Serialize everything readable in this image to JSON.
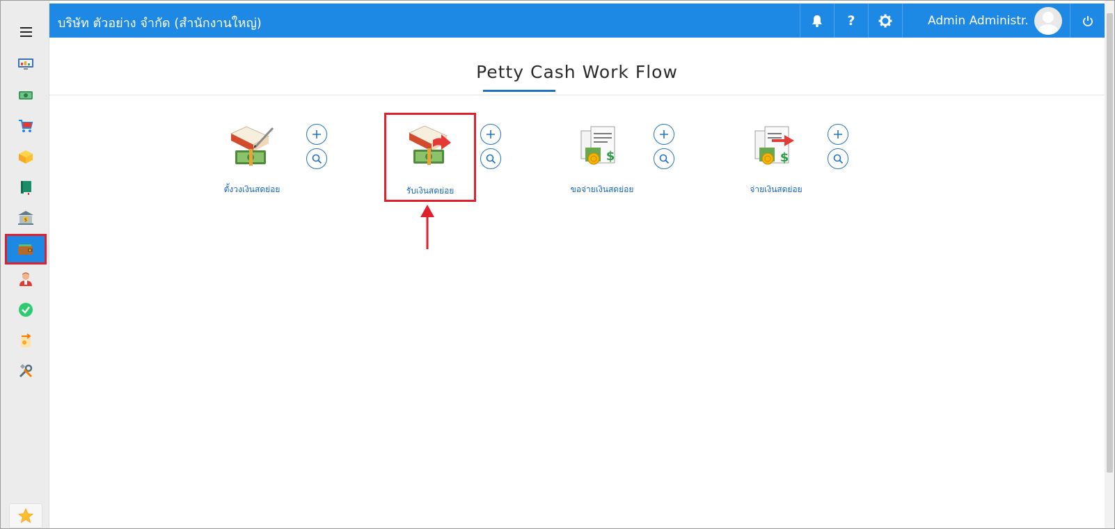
{
  "header": {
    "company": "บริษัท ตัวอย่าง จำกัด (สำนักงานใหญ่)",
    "user_name": "Admin Administr...",
    "icons": [
      "bell-icon",
      "help-icon",
      "gear-icon",
      "power-icon"
    ]
  },
  "sidebar": {
    "items": [
      {
        "name": "dashboard",
        "icon": "monitor-chart-icon"
      },
      {
        "name": "money",
        "icon": "banknote-icon"
      },
      {
        "name": "purchase",
        "icon": "cart-icon"
      },
      {
        "name": "inventory",
        "icon": "box-icon"
      },
      {
        "name": "ledger",
        "icon": "book-icon"
      },
      {
        "name": "bank",
        "icon": "bank-icon"
      },
      {
        "name": "petty-cash",
        "icon": "wallet-icon",
        "active": true
      },
      {
        "name": "hr",
        "icon": "person-icon"
      },
      {
        "name": "approve",
        "icon": "check-icon"
      },
      {
        "name": "transfer",
        "icon": "transfer-icon"
      },
      {
        "name": "settings",
        "icon": "tools-icon"
      }
    ],
    "favorite_icon": "star-icon"
  },
  "main": {
    "title": "Petty Cash Work Flow",
    "workflow": [
      {
        "label": "ตั้งวงเงินสดย่อย",
        "icon": "ledger-pen-icon"
      },
      {
        "label": "รับเงินสดย่อย",
        "icon": "ledger-arrow-icon",
        "highlighted": true
      },
      {
        "label": "ขอจ่ายเงินสดย่อย",
        "icon": "receipt-dollar-icon"
      },
      {
        "label": "จ่ายเงินสดย่อย",
        "icon": "receipt-arrow-icon"
      }
    ]
  },
  "colors": {
    "header_bg": "#1e88e5",
    "accent": "#1e73be",
    "highlight": "#e0202c"
  }
}
